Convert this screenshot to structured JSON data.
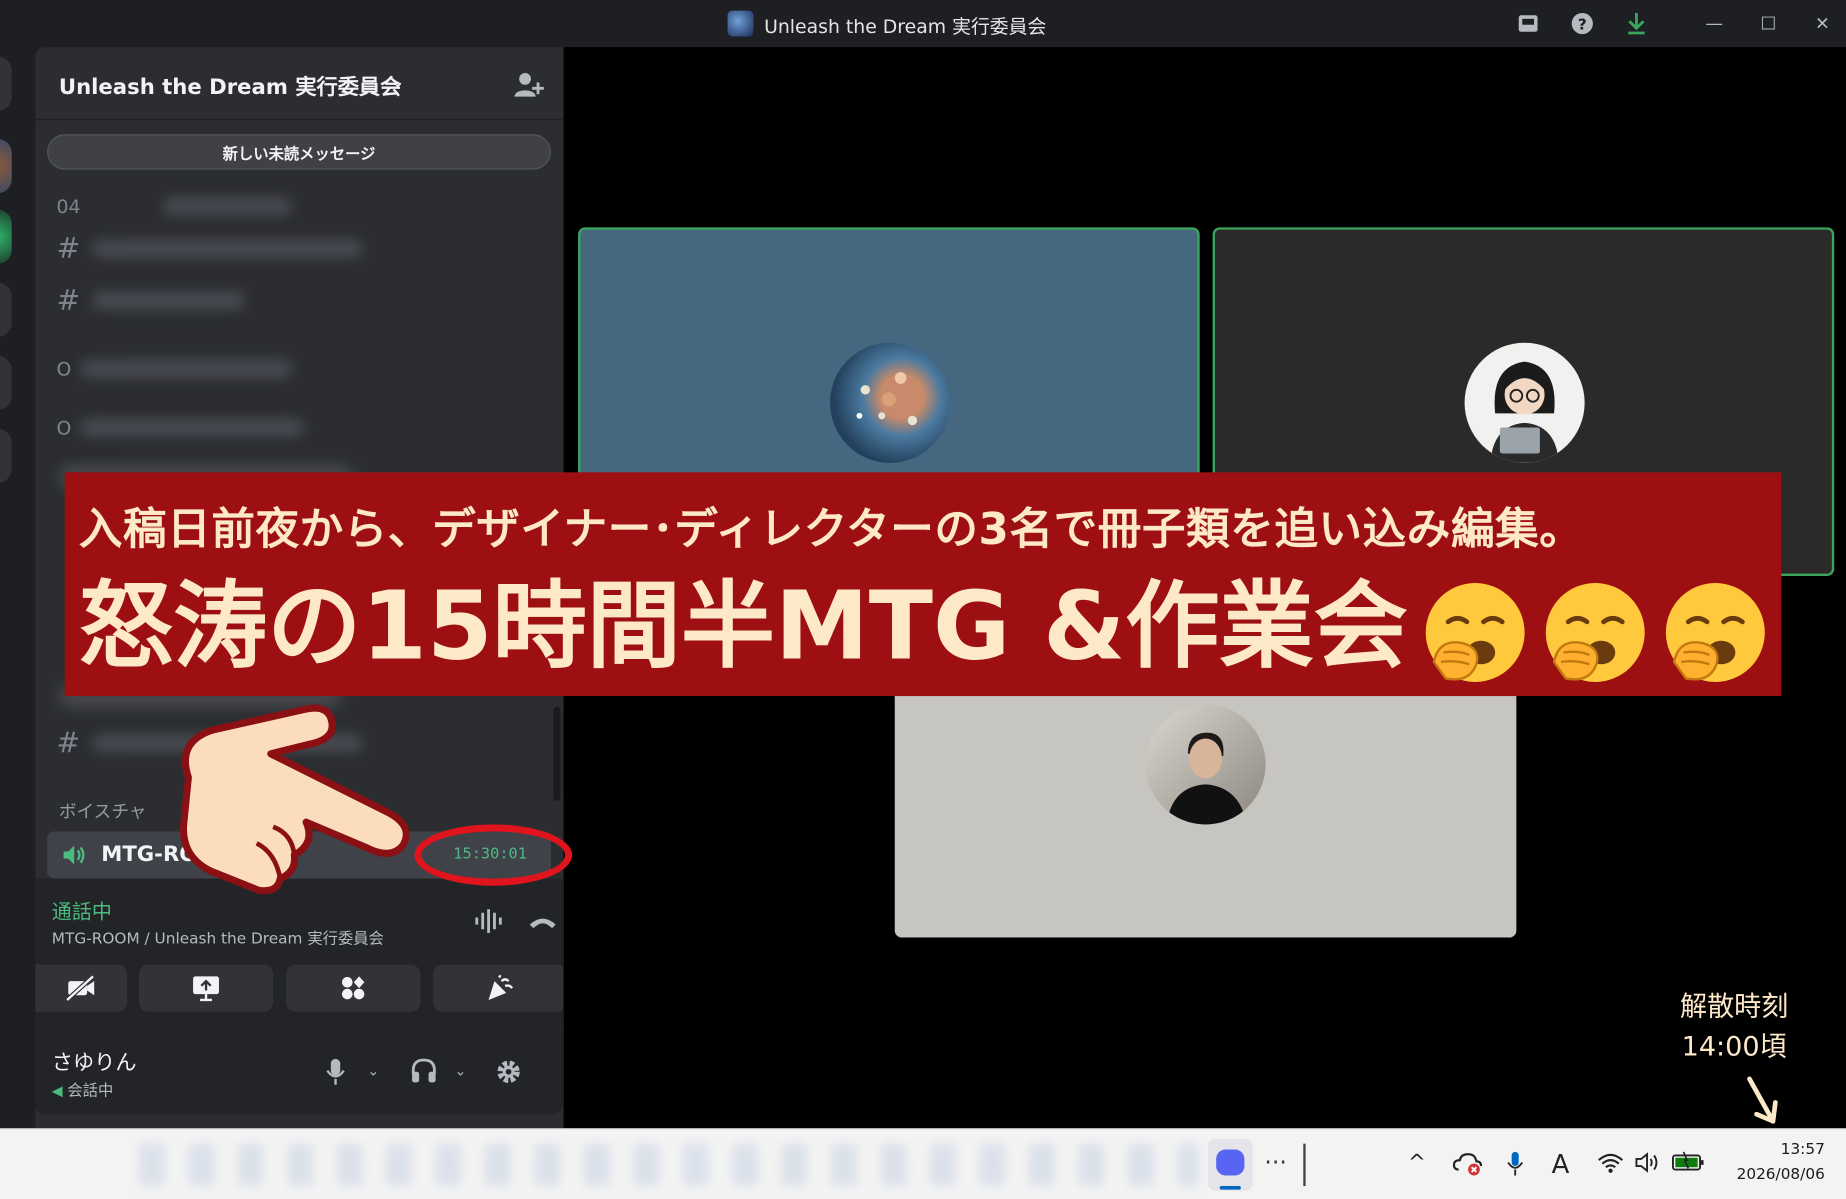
{
  "window": {
    "title": "Unleash the Dream 実行委員会",
    "controls": {
      "minimize": "—",
      "maximize": "☐",
      "close": "✕"
    }
  },
  "server": {
    "name": "Unleash the Dream 実行委員会",
    "unread_banner": "新しい未読メッセージ"
  },
  "channels": {
    "row_prefixes": [
      "04",
      "#",
      "#",
      "O",
      "O"
    ],
    "voice_category": "ボイスチャ",
    "voice_channel": {
      "name": "MTG-RO",
      "timer": "15:30:01"
    }
  },
  "voice_panel": {
    "status": "通話中",
    "location": "MTG-ROOM / Unleash the Dream 実行委員会"
  },
  "user": {
    "name": "さゆりん",
    "status": "会話中"
  },
  "overlay": {
    "line1": "入稿日前夜から、デザイナー･ディレクターの3名で冊子類を追い込み編集。",
    "line2": "怒涛の15時間半MTG &作業会",
    "emoji_count": 3,
    "dismiss_label": "解散時刻",
    "dismiss_time": "14:00頃"
  },
  "taskbar": {
    "time": "13:57",
    "date": "2026/08/06",
    "more": "···"
  },
  "icons": {
    "invite": "add-member-icon",
    "speaker": "speaker-icon",
    "waveform": "waveform-icon",
    "hangup": "hangup-icon",
    "camera_off": "camera-off-icon",
    "screen_share": "screen-share-icon",
    "activities": "activities-icon",
    "soundboard": "soundboard-icon",
    "mic": "microphone-icon",
    "headset": "headset-icon",
    "settings": "gear-icon"
  },
  "colors": {
    "banner_bg": "#9e0f12",
    "banner_text": "#fde8c8",
    "speaking_border": "#3ba55d",
    "connected_green": "#4cbb7f",
    "circle_red": "#e0141c"
  }
}
